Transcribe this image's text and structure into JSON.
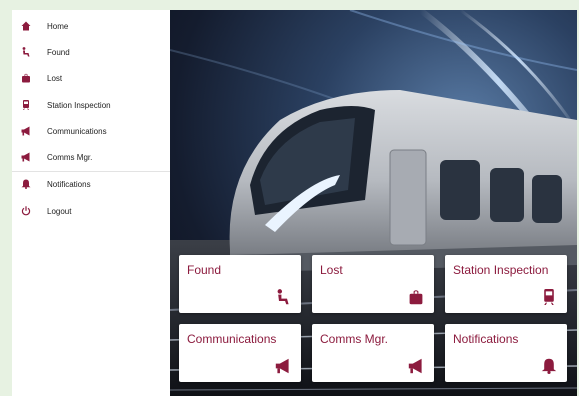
{
  "colors": {
    "accent": "#8c1b3e",
    "background": "#e7f2e2"
  },
  "sidebar": {
    "items": [
      {
        "label": "Home",
        "icon": "home-icon"
      },
      {
        "label": "Found",
        "icon": "person-sitting-icon"
      },
      {
        "label": "Lost",
        "icon": "bag-icon"
      },
      {
        "label": "Station Inspection",
        "icon": "train-icon"
      },
      {
        "label": "Communications",
        "icon": "megaphone-icon"
      },
      {
        "label": "Comms Mgr.",
        "icon": "megaphone-icon"
      },
      {
        "label": "Notifications",
        "icon": "bell-icon"
      },
      {
        "label": "Logout",
        "icon": "power-icon"
      }
    ]
  },
  "tiles": [
    {
      "label": "Found",
      "icon": "person-sitting-icon"
    },
    {
      "label": "Lost",
      "icon": "bag-icon"
    },
    {
      "label": "Station Inspection",
      "icon": "train-icon"
    },
    {
      "label": "Communications",
      "icon": "megaphone-icon"
    },
    {
      "label": "Comms Mgr.",
      "icon": "megaphone-icon"
    },
    {
      "label": "Notifications",
      "icon": "bell-icon"
    }
  ]
}
